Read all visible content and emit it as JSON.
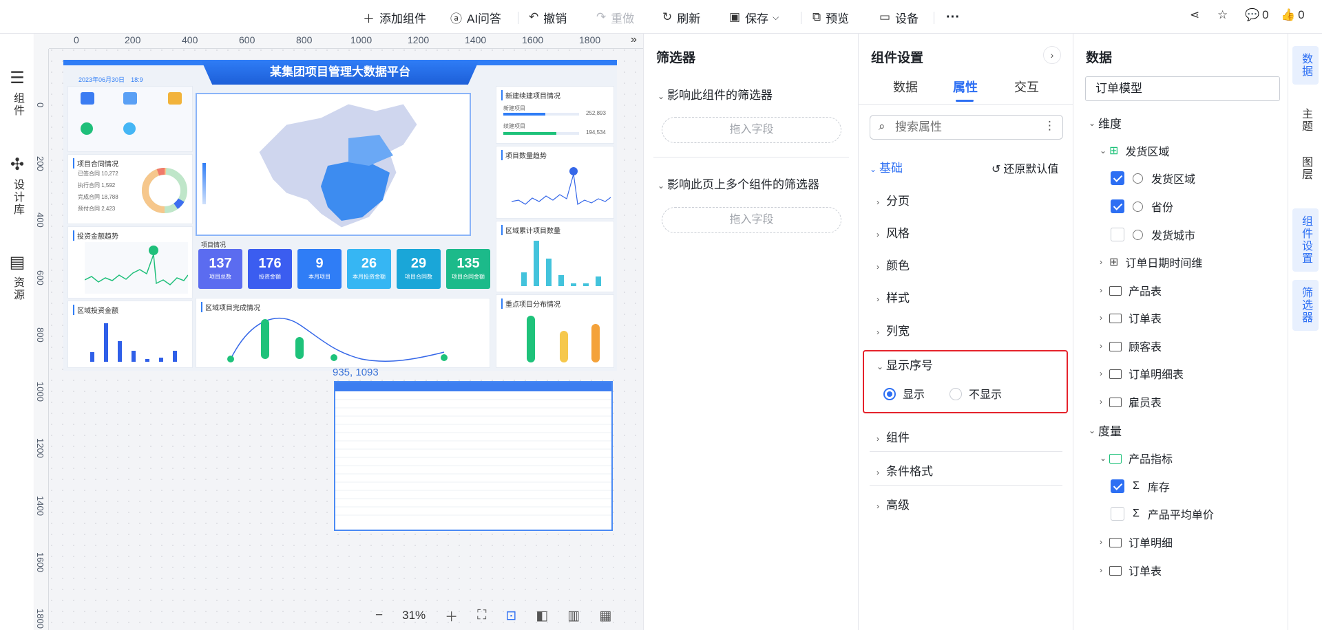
{
  "toolbar": {
    "add_component": "添加组件",
    "ai_qa": "AI问答",
    "undo": "撤销",
    "redo": "重做",
    "refresh": "刷新",
    "save": "保存",
    "preview": "预览",
    "device": "设备",
    "comment_count": "0",
    "like_count": "0"
  },
  "leftbar": {
    "components": "组件",
    "design_library": "设计库",
    "resources": "资源"
  },
  "rulers": {
    "h": [
      "0",
      "200",
      "400",
      "600",
      "800",
      "1000",
      "1200",
      "1400",
      "1600",
      "1800"
    ],
    "v": [
      "0",
      "200",
      "400",
      "600",
      "800",
      "1000",
      "1200",
      "1400",
      "1600",
      "1800"
    ]
  },
  "dashboard": {
    "title": "某集团项目管理大数据平台",
    "date": "2023年06月30日",
    "time": "18:9",
    "contract_title": "项目合同情况",
    "invest_trend_title": "投资金额趋势",
    "region_invest_title": "区域投资金额",
    "project_info_title": "项目情况",
    "region_complete_title": "区域项目完成情况",
    "new_project_title": "新建续建项目情况",
    "new_project_value": "252,893",
    "cont_project_value": "194,534",
    "new_project_label": "新建项目",
    "cont_project_label": "续建项目",
    "project_count_title": "项目数量趋势",
    "region_total_title": "区域累计项目数量",
    "key_project_title": "重点项目分布情况",
    "contract_rows": [
      "已签合同 10,272",
      "执行合同 1,592",
      "完成合同 18,788",
      "预付合同 2,423"
    ],
    "stats": [
      {
        "n": "137",
        "l": "项目总数"
      },
      {
        "n": "176",
        "l": "投资金额"
      },
      {
        "n": "9",
        "l": "本月项目"
      },
      {
        "n": "26",
        "l": "本月投资金额"
      },
      {
        "n": "29",
        "l": "项目合同数"
      },
      {
        "n": "135",
        "l": "项目合同金额"
      }
    ]
  },
  "table_coord": "935, 1093",
  "zoom": {
    "level": "31%"
  },
  "filter_panel": {
    "title": "筛选器",
    "sec1": "影响此组件的筛选器",
    "sec2": "影响此页上多个组件的筛选器",
    "drop": "拖入字段"
  },
  "settings": {
    "title": "组件设置",
    "tabs": [
      "数据",
      "属性",
      "交互"
    ],
    "search_placeholder": "搜索属性",
    "basic": "基础",
    "reset": "还原默认值",
    "items": [
      "分页",
      "风格",
      "颜色",
      "样式",
      "列宽"
    ],
    "show_index": "显示序号",
    "show": "显示",
    "hide": "不显示",
    "sections": [
      "组件",
      "条件格式",
      "高级"
    ]
  },
  "data_panel": {
    "title": "数据",
    "model": "订单模型",
    "dimension": "维度",
    "ship_region_group": "发货区域",
    "ship_region": "发货区域",
    "province": "省份",
    "ship_city": "发货城市",
    "order_date": "订单日期时间维",
    "tables": [
      "产品表",
      "订单表",
      "顾客表",
      "订单明细表",
      "雇员表"
    ],
    "measure": "度量",
    "product_metrics": "产品指标",
    "stock": "库存",
    "avg_price": "产品平均单价",
    "order_detail": "订单明细",
    "order_table": "订单表"
  },
  "rightbar": [
    "数据",
    "主题",
    "图层",
    "组件设置",
    "筛选器"
  ],
  "colors": {
    "accent": "#2d6ff3",
    "highlight": "#e5222b",
    "stat_colors": [
      "#5b6cf0",
      "#3b5df0",
      "#2f7df6",
      "#36b6f3",
      "#1aa6d8",
      "#1cba8a"
    ]
  }
}
